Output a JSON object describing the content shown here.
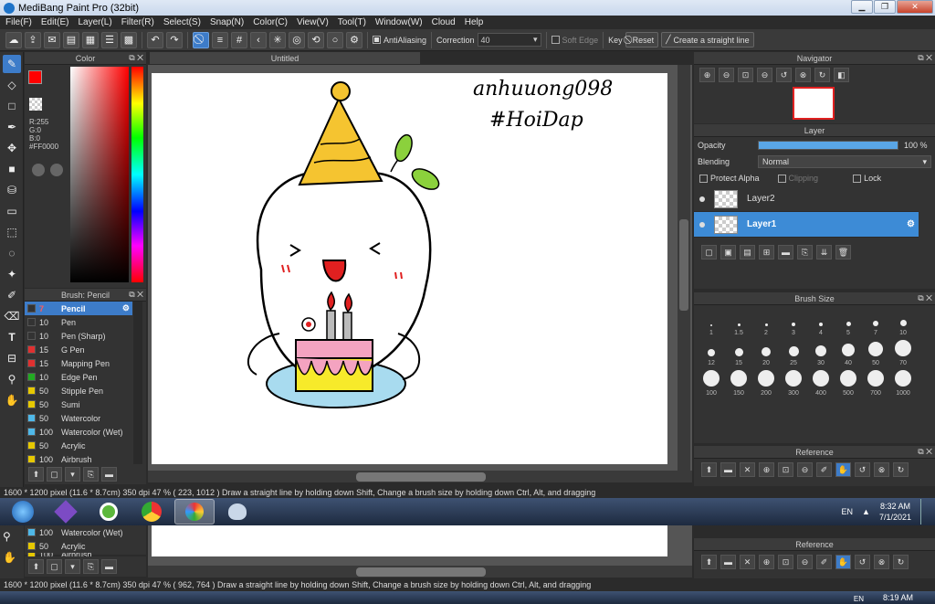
{
  "window": {
    "title": "MediBang Paint Pro (32bit)"
  },
  "menu": [
    "File(F)",
    "Edit(E)",
    "Layer(L)",
    "Filter(R)",
    "Select(S)",
    "Snap(N)",
    "Color(C)",
    "View(V)",
    "Tool(T)",
    "Window(W)",
    "Cloud",
    "Help"
  ],
  "toolbar": {
    "antialiasing": "AntiAliasing",
    "correction_label": "Correction",
    "correction_value": "40",
    "soft_edge": "Soft Edge",
    "key_label": "Key",
    "reset": "Reset",
    "create_line": "Create a straight line"
  },
  "color": {
    "title": "Color",
    "r": "R:255",
    "g": "G:0",
    "b": "B:0",
    "hex": "#FF0000",
    "fg": "#ff0000",
    "bg": "#000000"
  },
  "brush": {
    "title": "Brush: Pencil",
    "items": [
      {
        "size": "7",
        "name": "Pencil",
        "color": "#333333"
      },
      {
        "size": "10",
        "name": "Pen",
        "color": "#333333"
      },
      {
        "size": "10",
        "name": "Pen (Sharp)",
        "color": "#333333"
      },
      {
        "size": "15",
        "name": "G Pen",
        "color": "#e03030"
      },
      {
        "size": "15",
        "name": "Mapping Pen",
        "color": "#e03030"
      },
      {
        "size": "10",
        "name": "Edge Pen",
        "color": "#22aa22"
      },
      {
        "size": "50",
        "name": "Stipple Pen",
        "color": "#e6c800"
      },
      {
        "size": "50",
        "name": "Sumi",
        "color": "#e6c800"
      },
      {
        "size": "50",
        "name": "Watercolor",
        "color": "#4fb8e8"
      },
      {
        "size": "100",
        "name": "Watercolor (Wet)",
        "color": "#4fb8e8"
      },
      {
        "size": "50",
        "name": "Acrylic",
        "color": "#e6c800"
      },
      {
        "size": "100",
        "name": "Airbrush",
        "color": "#e6c800"
      }
    ]
  },
  "canvas": {
    "tab": "Untitled",
    "handwriting_line1": "anhuuong098",
    "handwriting_line2": "#HoiDap"
  },
  "navigator": {
    "title": "Navigator"
  },
  "layer": {
    "title": "Layer",
    "opacity_label": "Opacity",
    "opacity_value": "100 %",
    "opacity_fraction": 1.0,
    "blending_label": "Blending",
    "blending_value": "Normal",
    "protect_alpha": "Protect Alpha",
    "clipping": "Clipping",
    "lock": "Lock",
    "layers": [
      "Layer2",
      "Layer1"
    ]
  },
  "brushsize": {
    "title": "Brush Size",
    "sizes": [
      "1",
      "1.5",
      "2",
      "3",
      "4",
      "5",
      "7",
      "10",
      "12",
      "15",
      "20",
      "25",
      "30",
      "40",
      "50",
      "70",
      "100",
      "150",
      "200",
      "300",
      "400",
      "500",
      "700",
      "1000"
    ]
  },
  "reference": {
    "title": "Reference"
  },
  "status": {
    "text": "1600 * 1200 pixel   (11.6 * 8.7cm)   350 dpi   47 %   ( 223, 1012 )   Draw a straight line by holding down Shift, Change a brush size by holding down Ctrl, Alt, and dragging",
    "text2": "1600 * 1200 pixel   (11.6 * 8.7cm)   350 dpi   47 %   ( 962, 764 )   Draw a straight line by holding down Shift, Change a brush size by holding down Ctrl, Alt, and dragging"
  },
  "taskbar": {
    "lang": "EN",
    "time": "8:32 AM",
    "date": "7/1/2021",
    "lang2": "EN",
    "time2": "8:19 AM"
  }
}
